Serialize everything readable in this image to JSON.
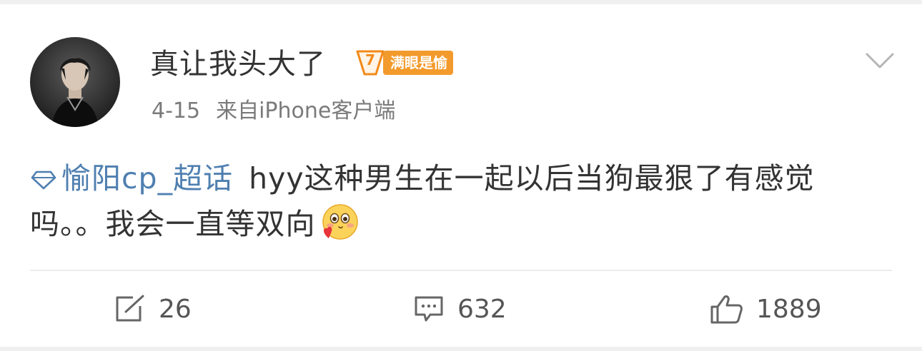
{
  "post": {
    "author": {
      "name": "真让我头大了",
      "badge_level": "7",
      "badge_label": "满眼是愉"
    },
    "meta": {
      "date": "4-15",
      "source": "来自iPhone客户端"
    },
    "content": {
      "topic": "愉阳cp_超话",
      "text": "hyy这种男生在一起以后当狗最狠了有感觉吗。。我会一直等双向",
      "emoji": "blush-heart-emoji"
    },
    "actions": {
      "reposts": "26",
      "comments": "632",
      "likes": "1889"
    }
  },
  "icons": {
    "more": "chevron-down-icon",
    "topic": "diamond-icon",
    "repost": "repost-icon",
    "comment": "comment-icon",
    "like": "thumbs-up-icon"
  },
  "colors": {
    "topic_link": "#4f7fb0",
    "badge": "#f39a2c",
    "text": "#333333",
    "meta": "#7a7a7a"
  }
}
